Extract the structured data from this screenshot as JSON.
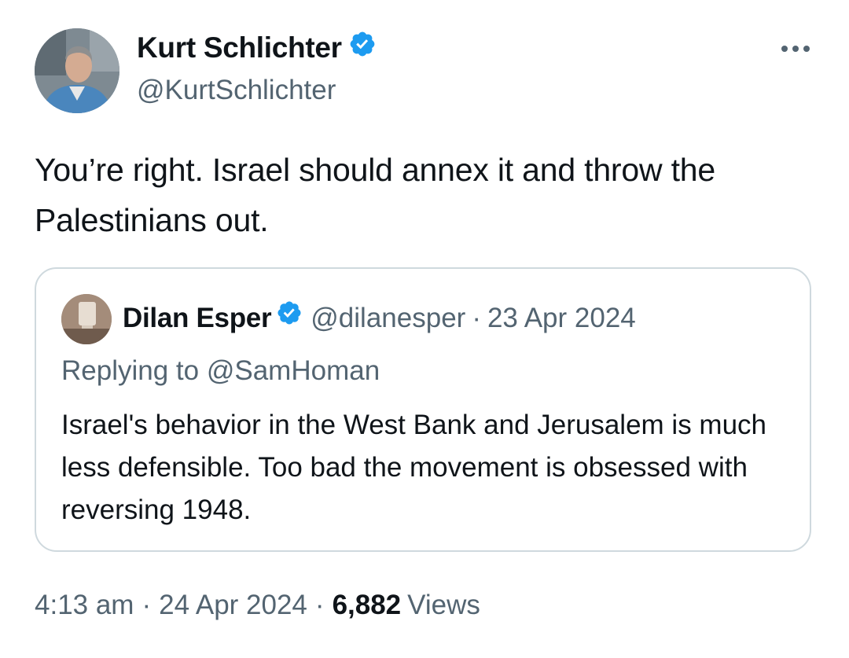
{
  "author": {
    "name": "Kurt Schlichter",
    "handle": "@KurtSchlichter",
    "verified": true
  },
  "menu": {
    "more_icon": "more-horizontal-icon"
  },
  "tweet": {
    "text": "You’re right. Israel should annex it and throw the Palestinians out."
  },
  "quoted": {
    "name": "Dilan Esper",
    "handle": "@dilanesper",
    "separator": "·",
    "date": "23 Apr 2024",
    "replying_prefix": "Replying to",
    "replying_to": "@SamHoman",
    "text": "Israel's behavior in the West Bank and Jerusalem is much less defensible. Too bad the movement is obsessed with reversing 1948."
  },
  "meta": {
    "time": "4:13 am",
    "separator": "·",
    "date": "24 Apr 2024",
    "views_count": "6,882",
    "views_label": "Views"
  },
  "colors": {
    "verified_blue": "#1d9bf0",
    "text_primary": "#0f1419",
    "text_secondary": "#536471",
    "border": "#cfd9de"
  }
}
